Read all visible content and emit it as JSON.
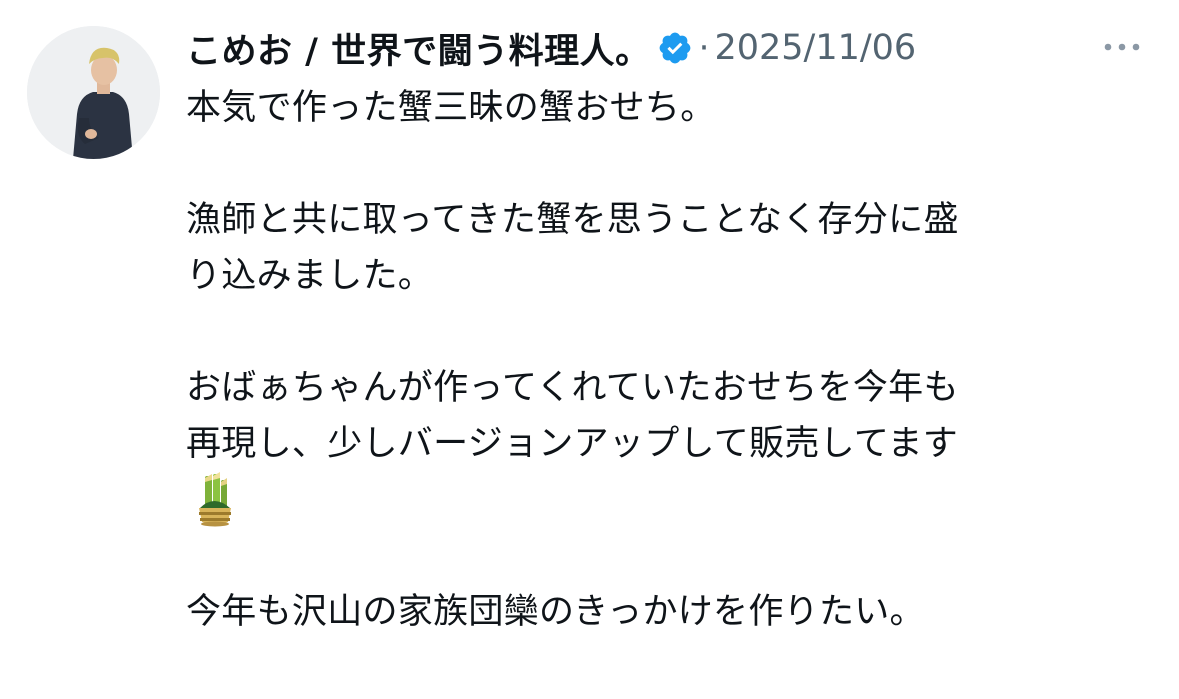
{
  "post": {
    "display_name": "こめお / 世界で闘う料理人。",
    "separator": "·",
    "date": "2025/11/06",
    "lines": [
      "本気で作った蟹三昧の蟹おせち。",
      "",
      "漁師と共に取ってきた蟹を思うことなく存分に盛",
      "り込みました。",
      "",
      "おばぁちゃんが作ってくれていたおせちを今年も",
      "再現し、少しバージョンアップして販売してます",
      "🎍",
      "",
      "今年も沢山の家族団欒のきっかけを作りたい。"
    ]
  },
  "icons": {
    "verified": "verified-badge-icon",
    "more": "more-options-icon",
    "emoji": "kadomatsu-emoji"
  },
  "colors": {
    "text": "#0f1419",
    "secondary": "#536471",
    "verified_blue": "#1d9bf0"
  }
}
